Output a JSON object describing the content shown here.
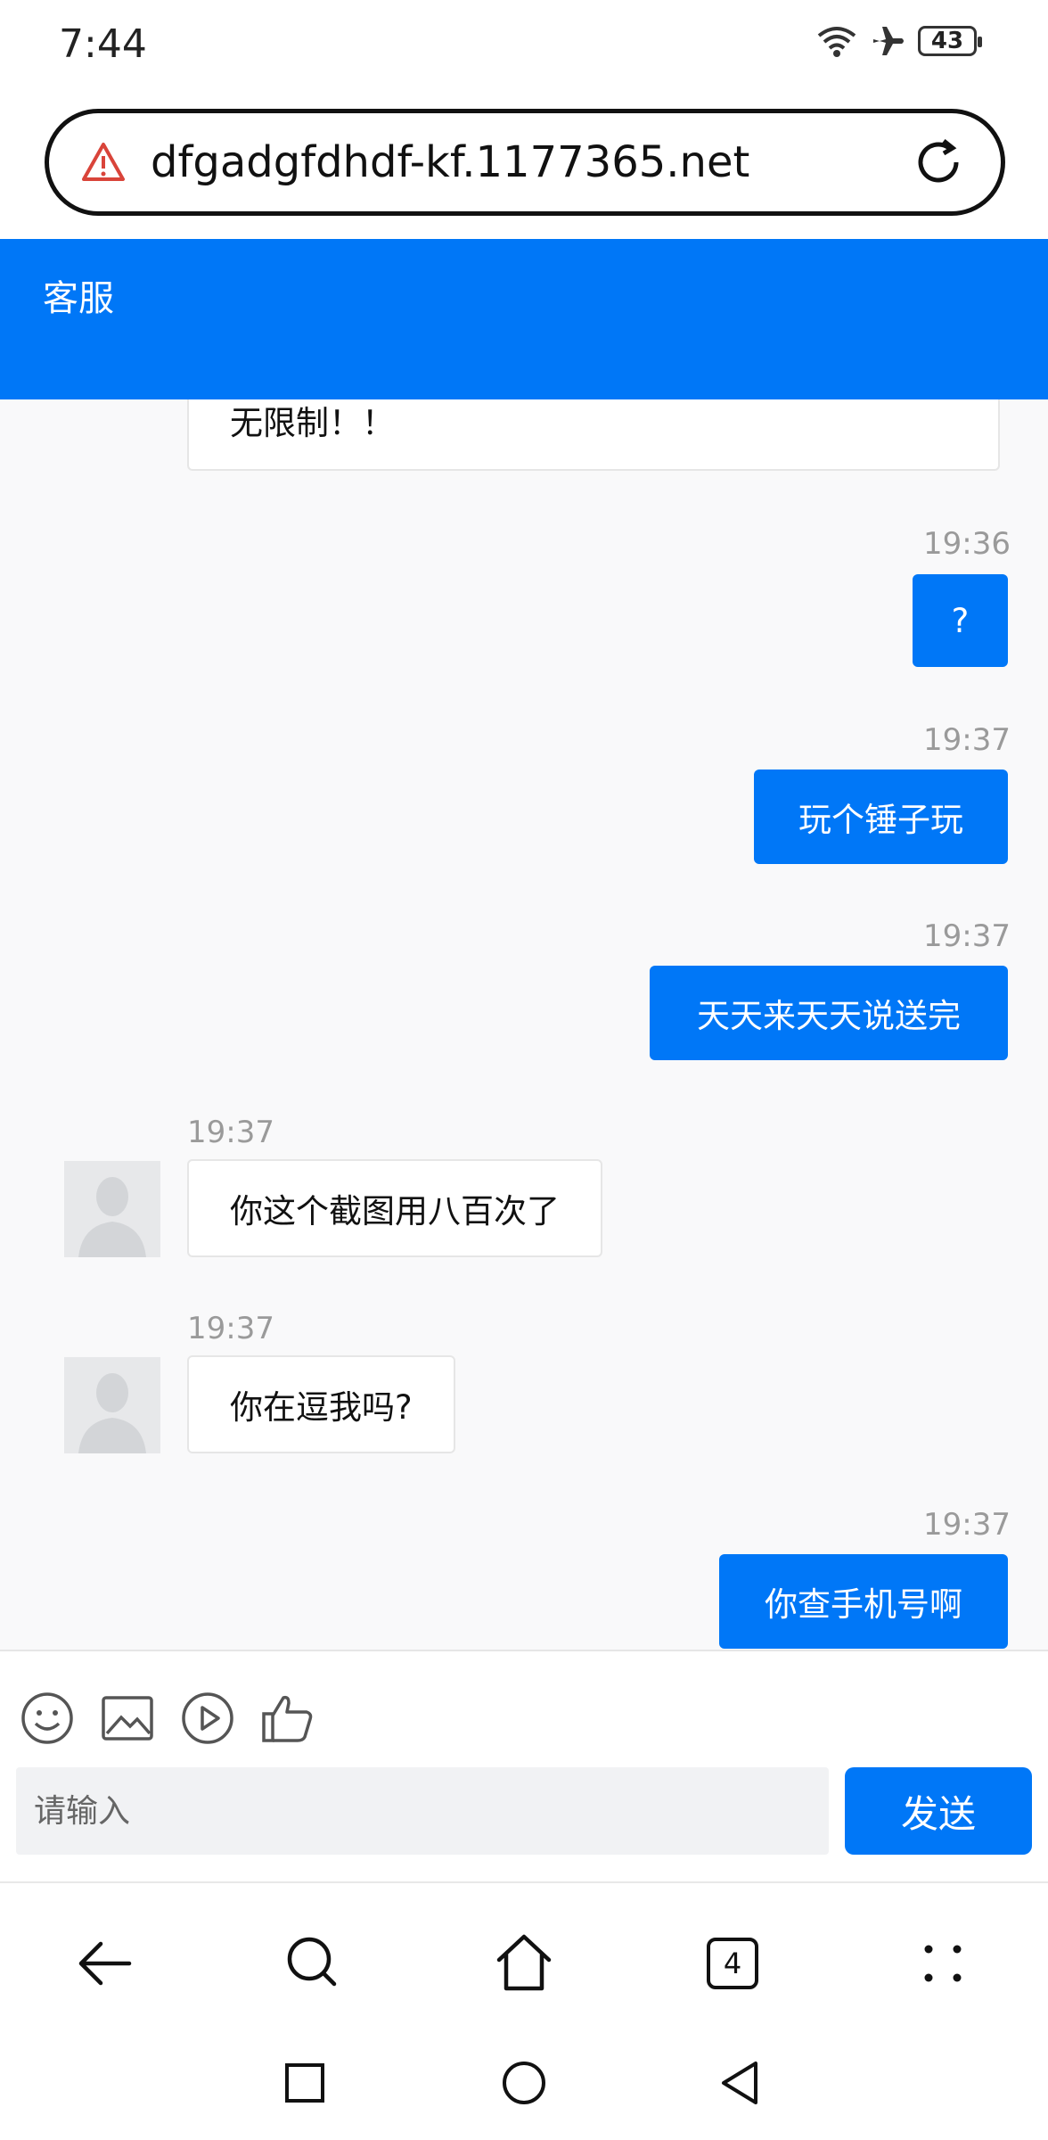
{
  "status_bar": {
    "time": "7:44",
    "battery": "43"
  },
  "address_bar": {
    "url": "dfgadgfdhdf-kf.1177365.net"
  },
  "header": {
    "title": "客服"
  },
  "chat": {
    "partial_message": "无限制！！",
    "messages": [
      {
        "side": "out",
        "time": "19:36",
        "text": "?"
      },
      {
        "side": "out",
        "time": "19:37",
        "text": "玩个锤子玩"
      },
      {
        "side": "out",
        "time": "19:37",
        "text": "天天来天天说送完"
      },
      {
        "side": "in",
        "time": "19:37",
        "text": "你这个截图用八百次了"
      },
      {
        "side": "in",
        "time": "19:37",
        "text": "你在逗我吗?"
      },
      {
        "side": "out",
        "time": "19:37",
        "text": "你查手机号啊"
      }
    ]
  },
  "composer": {
    "toolbar_icons": [
      "emoji-icon",
      "image-icon",
      "video-icon",
      "thumbs-up-icon"
    ],
    "placeholder": "请输入",
    "send_label": "发送"
  },
  "browser_nav": {
    "icons": [
      "back-arrow-icon",
      "search-icon",
      "home-icon",
      "tabs-icon",
      "more-icon"
    ],
    "tab_count": "4"
  },
  "system_nav": {
    "icons": [
      "recents-icon",
      "home-circle-icon",
      "back-triangle-icon"
    ]
  },
  "colors": {
    "accent": "#0077f7",
    "chat_bg": "#f9f9fa",
    "warning": "#d9443a"
  }
}
